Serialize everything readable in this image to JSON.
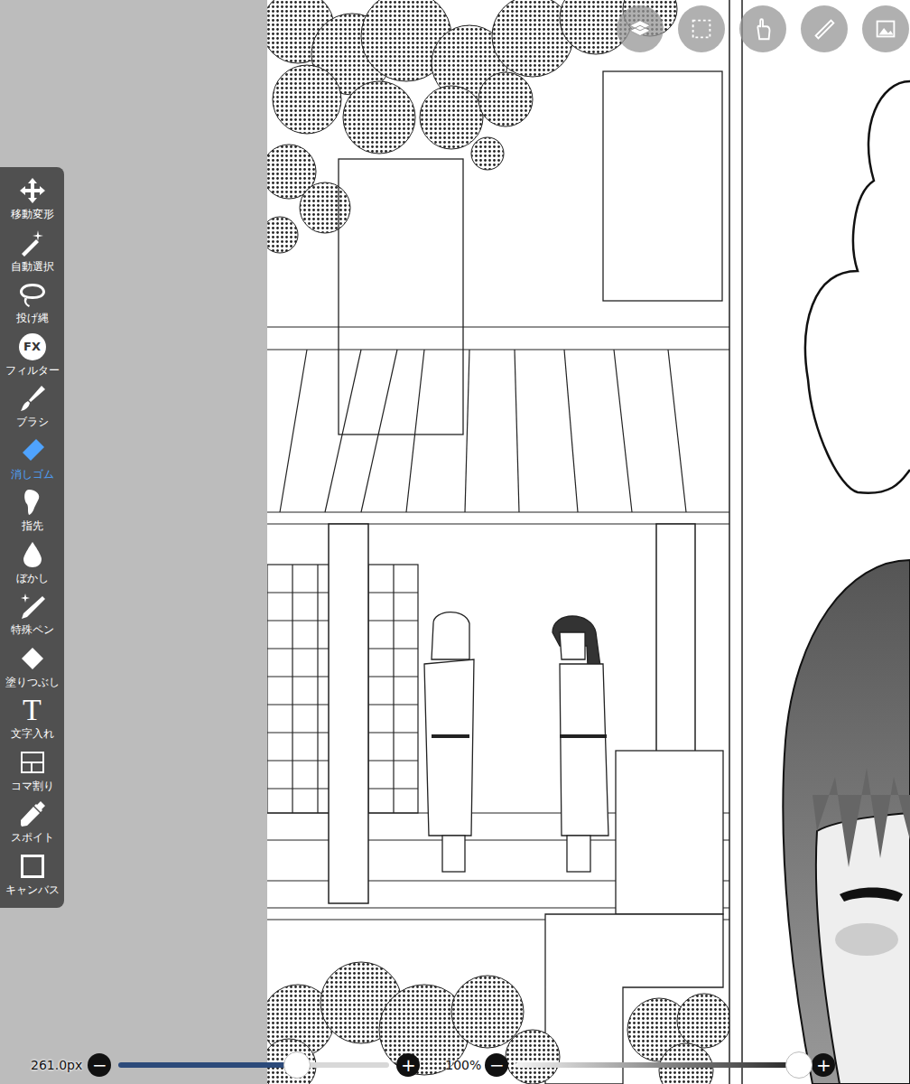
{
  "toolbar": {
    "tools": [
      {
        "label": "移動変形",
        "selected": false,
        "kind": "icon",
        "glyph": ""
      },
      {
        "label": "自動選択",
        "selected": false,
        "kind": "icon",
        "glyph": ""
      },
      {
        "label": "投げ縄",
        "selected": false,
        "kind": "icon",
        "glyph": ""
      },
      {
        "label": "フィルター",
        "selected": false,
        "kind": "badge",
        "glyph": "FX"
      },
      {
        "label": "ブラシ",
        "selected": false,
        "kind": "icon",
        "glyph": ""
      },
      {
        "label": "消しゴム",
        "selected": true,
        "kind": "icon",
        "glyph": ""
      },
      {
        "label": "指先",
        "selected": false,
        "kind": "icon",
        "glyph": ""
      },
      {
        "label": "ぼかし",
        "selected": false,
        "kind": "icon",
        "glyph": ""
      },
      {
        "label": "特殊ペン",
        "selected": false,
        "kind": "icon",
        "glyph": ""
      },
      {
        "label": "塗りつぶし",
        "selected": false,
        "kind": "icon",
        "glyph": ""
      },
      {
        "label": "文字入れ",
        "selected": false,
        "kind": "glyph",
        "glyph": "T"
      },
      {
        "label": "コマ割り",
        "selected": false,
        "kind": "icon",
        "glyph": ""
      },
      {
        "label": "スポイト",
        "selected": false,
        "kind": "icon",
        "glyph": ""
      },
      {
        "label": "キャンバス",
        "selected": false,
        "kind": "icon",
        "glyph": ""
      }
    ]
  },
  "brush_size": {
    "reading": "261.0px",
    "level": 0.66,
    "minus": "−",
    "plus": "+"
  },
  "opacity": {
    "reading": "100%",
    "level": 0.98,
    "minus": "−",
    "plus": "+"
  }
}
